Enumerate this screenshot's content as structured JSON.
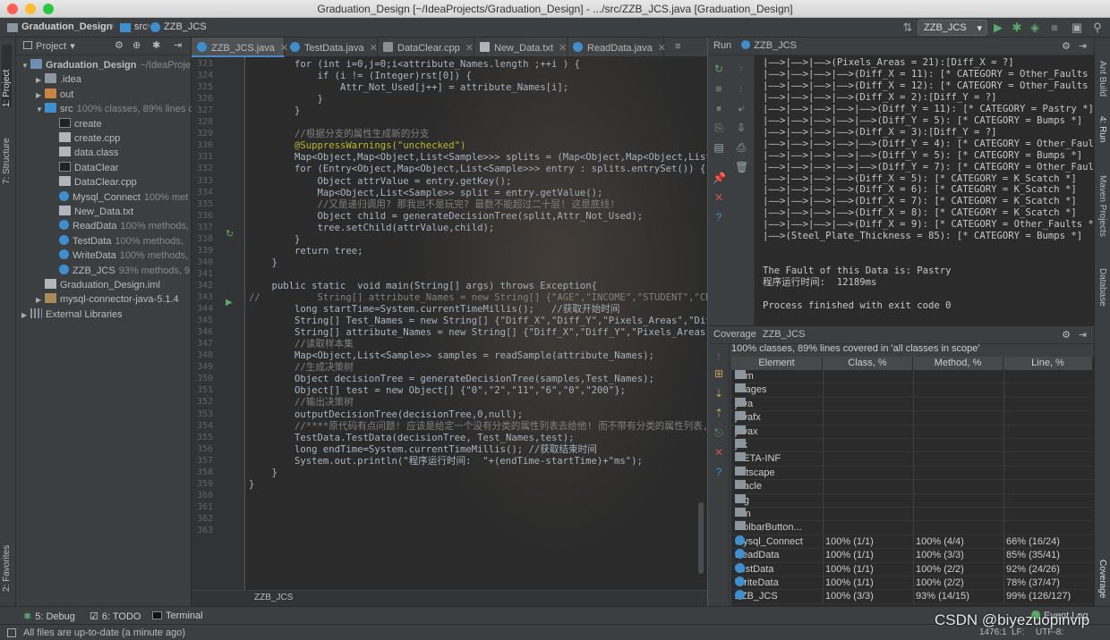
{
  "window": {
    "title": "Graduation_Design [~/IdeaProjects/Graduation_Design] - .../src/ZZB_JCS.java [Graduation_Design]"
  },
  "navbar": {
    "crumbs": [
      "Graduation_Design",
      "src",
      "ZZB_JCS"
    ],
    "run_config": "ZZB_JCS"
  },
  "left_tool_tabs": [
    "1: Project",
    "7: Structure",
    "2: Favorites"
  ],
  "project": {
    "header": "Project",
    "tree": [
      {
        "label": "Graduation_Design",
        "extra": "~/IdeaProje",
        "type": "module",
        "arrow": "▼",
        "depth": 0
      },
      {
        "label": ".idea",
        "extra": "",
        "type": "folder",
        "arrow": "▶",
        "depth": 1
      },
      {
        "label": "out",
        "extra": "",
        "type": "folder-orange",
        "arrow": "▶",
        "depth": 1
      },
      {
        "label": "src",
        "extra": "100% classes, 89% lines c",
        "type": "folder-blue",
        "arrow": "▼",
        "depth": 1
      },
      {
        "label": "create",
        "extra": "",
        "type": "cmd",
        "arrow": "",
        "depth": 2
      },
      {
        "label": "create.cpp",
        "extra": "",
        "type": "file",
        "arrow": "",
        "depth": 2
      },
      {
        "label": "data.class",
        "extra": "",
        "type": "file",
        "arrow": "",
        "depth": 2
      },
      {
        "label": "DataClear",
        "extra": "",
        "type": "cmd",
        "arrow": "",
        "depth": 2
      },
      {
        "label": "DataClear.cpp",
        "extra": "",
        "type": "file",
        "arrow": "",
        "depth": 2
      },
      {
        "label": "Mysql_Connect",
        "extra": "100% met",
        "type": "class",
        "arrow": "",
        "depth": 2
      },
      {
        "label": "New_Data.txt",
        "extra": "",
        "type": "file",
        "arrow": "",
        "depth": 2
      },
      {
        "label": "ReadData",
        "extra": "100% methods,",
        "type": "class",
        "arrow": "",
        "depth": 2
      },
      {
        "label": "TestData",
        "extra": "100% methods,",
        "type": "class",
        "arrow": "",
        "depth": 2
      },
      {
        "label": "WriteData",
        "extra": "100% methods,",
        "type": "class",
        "arrow": "",
        "depth": 2
      },
      {
        "label": "ZZB_JCS",
        "extra": "93% methods, 9",
        "type": "class",
        "arrow": "",
        "depth": 2
      },
      {
        "label": "Graduation_Design.iml",
        "extra": "",
        "type": "file",
        "arrow": "",
        "depth": 1
      },
      {
        "label": "mysql-connector-java-5.1.4",
        "extra": "",
        "type": "jar",
        "arrow": "▶",
        "depth": 1
      },
      {
        "label": "External Libraries",
        "extra": "",
        "type": "lib",
        "arrow": "▶",
        "depth": 0
      }
    ]
  },
  "editor": {
    "tabs": [
      "ZZB_JCS.java",
      "TestData.java",
      "DataClear.cpp",
      "New_Data.txt",
      "ReadData.java"
    ],
    "active_tab": 0,
    "footer": "ZZB_JCS",
    "line_numbers": [
      "323",
      "324",
      "325",
      "326",
      "327",
      "328",
      "329",
      "330",
      "331",
      "332",
      "333",
      "334",
      "335",
      "336",
      "337",
      "338",
      "339",
      "340",
      "341",
      "342",
      "343",
      "344",
      "345",
      "346",
      "347",
      "348",
      "349",
      "350",
      "351",
      "352",
      "353",
      "354",
      "355",
      "356",
      "357",
      "358",
      "359",
      "360",
      "361",
      "362",
      "363"
    ],
    "lines": [
      "        for (int i=0,j=0;i<attribute_Names.length ;++i ) {",
      "            if (i != (Integer)rst[0]) {",
      "                Attr_Not_Used[j++] = attribute_Names[i];",
      "            }",
      "        }",
      "",
      "        //根据分支的属性生成新的分支",
      "        @SuppressWarnings(\"unchecked\")",
      "        Map<Object,Map<Object,List<Sample>>> splits = (Map<Object,Map<Object,List<Sam",
      "        for (Entry<Object,Map<Object,List<Sample>>> entry : splits.entrySet()) {",
      "            Object attrValue = entry.getKey();",
      "            Map<Object,List<Sample>> split = entry.getValue();",
      "            //又是递归调用? 那我岂不是玩完? 最数不能超过二十层! 这是底线!",
      "            Object child = generateDecisionTree(split,Attr_Not_Used);",
      "            tree.setChild(attrValue,child);",
      "        }",
      "        return tree;",
      "    }",
      "",
      "    public static  void main(String[] args) throws Exception{",
      "//          String[] attribute_Names = new String[] {\"AGE\",\"INCOME\",\"STUDENT\",\"CREDIT_R",
      "        long startTime=System.currentTimeMillis();   //获取开始时间",
      "        String[] Test_Names = new String[] {\"Diff_X\",\"Diff_Y\",\"Pixels_Areas\",\"Diff_Lu",
      "        String[] attribute_Names = new String[] {\"Diff_X\",\"Diff_Y\",\"Pixels_Areas\",\"Di",
      "        //读取样本集",
      "        Map<Object,List<Sample>> samples = readSample(attribute_Names);",
      "        //生成决策树",
      "        Object decisionTree = generateDecisionTree(samples,Test_Names);",
      "        Object[] test = new Object[] {\"0\",\"2\",\"11\",\"6\",\"0\",\"200\"};",
      "        //输出决策树",
      "        outputDecisionTree(decisionTree,0,null);",
      "        //****原代码有点问题! 应该是给定一个没有分类的属性列表去给他! 而不带有分类的属性列表, 这",
      "        TestData.TestData(decisionTree, Test_Names,test);",
      "        long endTime=System.currentTimeMillis(); //获取结束时间",
      "        System.out.println(\"程序运行时间:  \"+(endTime-startTime)+\"ms\");",
      "    }",
      "}",
      "",
      "",
      "",
      ""
    ]
  },
  "run": {
    "header": "Run",
    "config": "ZZB_JCS",
    "output": [
      "|——>|——>|——>(Pixels_Areas = 21):[Diff_X = ?]",
      "|——>|——>|——>|——>(Diff_X = 11): [* CATEGORY = Other_Faults *]",
      "|——>|——>|——>|——>(Diff_X = 12): [* CATEGORY = Other_Faults *]",
      "|——>|——>|——>|——>(Diff_X = 2):[Diff_Y = ?]",
      "|——>|——>|——>|——>|——>(Diff_Y = 11): [* CATEGORY = Pastry *]",
      "|——>|——>|——>|——>|——>(Diff_Y = 5): [* CATEGORY = Bumps *]",
      "|——>|——>|——>|——>(Diff_X = 3):[Diff_Y = ?]",
      "|——>|——>|——>|——>|——>(Diff_Y = 4): [* CATEGORY = Other_Faul",
      "|——>|——>|——>|——>|——>(Diff_Y = 5): [* CATEGORY = Bumps *]",
      "|——>|——>|——>|——>|——>(Diff_Y = 7): [* CATEGORY = Other_Faul",
      "|——>|——>|——>|——>(Diff_X = 5): [* CATEGORY = K_Scatch *]",
      "|——>|——>|——>|——>(Diff_X = 6): [* CATEGORY = K_Scatch *]",
      "|——>|——>|——>|——>(Diff_X = 7): [* CATEGORY = K_Scatch *]",
      "|——>|——>|——>|——>(Diff_X = 8): [* CATEGORY = K_Scatch *]",
      "|——>|——>|——>|——>(Diff_X = 9): [* CATEGORY = Other_Faults *]",
      "|——>(Steel_Plate_Thickness = 85): [* CATEGORY = Bumps *]",
      "",
      "",
      "The Fault of this Data is: Pastry",
      "程序运行时间:  12189ms",
      "",
      "Process finished with exit code 0"
    ]
  },
  "coverage": {
    "header": "Coverage",
    "config": "ZZB_JCS",
    "summary": "100% classes, 89% lines covered in 'all classes in scope'",
    "columns": [
      "Element",
      "Class, %",
      "Method, %",
      "Line, %"
    ],
    "rows": [
      {
        "name": "com",
        "type": "pkg",
        "cls": "",
        "meth": "",
        "line": ""
      },
      {
        "name": "images",
        "type": "pkg",
        "cls": "",
        "meth": "",
        "line": ""
      },
      {
        "name": "java",
        "type": "pkg",
        "cls": "",
        "meth": "",
        "line": ""
      },
      {
        "name": "javafx",
        "type": "pkg",
        "cls": "",
        "meth": "",
        "line": ""
      },
      {
        "name": "javax",
        "type": "pkg",
        "cls": "",
        "meth": "",
        "line": ""
      },
      {
        "name": "jdk",
        "type": "pkg",
        "cls": "",
        "meth": "",
        "line": ""
      },
      {
        "name": "META-INF",
        "type": "pkg",
        "cls": "",
        "meth": "",
        "line": ""
      },
      {
        "name": "netscape",
        "type": "pkg",
        "cls": "",
        "meth": "",
        "line": ""
      },
      {
        "name": "oracle",
        "type": "pkg",
        "cls": "",
        "meth": "",
        "line": ""
      },
      {
        "name": "org",
        "type": "pkg",
        "cls": "",
        "meth": "",
        "line": ""
      },
      {
        "name": "sun",
        "type": "pkg",
        "cls": "",
        "meth": "",
        "line": ""
      },
      {
        "name": "toolbarButton...",
        "type": "pkg",
        "cls": "",
        "meth": "",
        "line": ""
      },
      {
        "name": "Mysql_Connect",
        "type": "class",
        "cls": "100% (1/1)",
        "meth": "100% (4/4)",
        "line": "66% (16/24)"
      },
      {
        "name": "ReadData",
        "type": "class",
        "cls": "100% (1/1)",
        "meth": "100% (3/3)",
        "line": "85% (35/41)"
      },
      {
        "name": "TestData",
        "type": "class",
        "cls": "100% (1/1)",
        "meth": "100% (2/2)",
        "line": "92% (24/26)"
      },
      {
        "name": "WriteData",
        "type": "class",
        "cls": "100% (1/1)",
        "meth": "100% (2/2)",
        "line": "78% (37/47)"
      },
      {
        "name": "ZZB_JCS",
        "type": "class",
        "cls": "100% (3/3)",
        "meth": "93% (14/15)",
        "line": "99% (126/127)"
      }
    ]
  },
  "right_tool_tabs": [
    "Ant Build",
    "4: Run",
    "Maven Projects",
    "Database",
    "Coverage"
  ],
  "bottom_tabs": [
    "5: Debug",
    "6: TODO",
    "Terminal"
  ],
  "status": {
    "message": "All files are up-to-date (a minute ago)",
    "event_log": "Event Log",
    "position": "1476:1",
    "line_sep": "LF:",
    "encoding": "UTF-8:"
  },
  "watermark": "CSDN @biyezuopinvip",
  "colors": {
    "keyword": "#cc7832",
    "string": "#6a8759",
    "comment": "#808080",
    "method": "#ffc66d",
    "accent": "#4a88c7"
  }
}
